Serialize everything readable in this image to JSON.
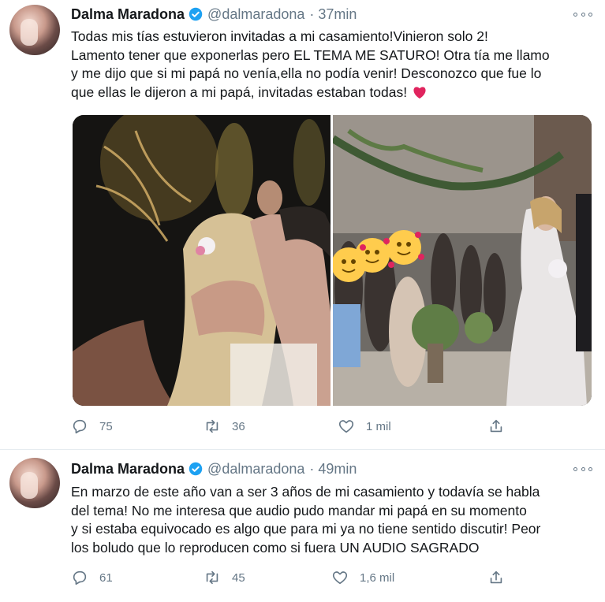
{
  "tweets": [
    {
      "author": "Dalma Maradona",
      "handle": "@dalmaradona",
      "time": "· 37min",
      "text": "Todas mis tías estuvieron invitadas a mi casamiento!Vinieron solo 2!\nLamento tener que exponerlas pero EL TEMA ME SATURO! Otra tía me llamo\ny me dijo que si mi papá no venía,ella no podía venir! Desconozco que fue lo\nque ellas le dijeron a mi papá, invitadas estaban todas!",
      "replies": "75",
      "retweets": "36",
      "likes": "1 mil"
    },
    {
      "author": "Dalma Maradona",
      "handle": "@dalmaradona",
      "time": "· 49min",
      "text": "En marzo de este año van a ser 3 años de mi casamiento y todavía se habla\ndel tema! No me interesa que audio pudo mandar mi papá en su momento\ny si estaba equivocado es algo que para mi ya no tiene sentido discutir! Peor\nlos boludo que lo reproducen como si fuera UN AUDIO SAGRADO",
      "replies": "61",
      "retweets": "45",
      "likes": "1,6 mil"
    }
  ],
  "colors": {
    "verified": "#1da1f2",
    "heart": "#e0245e",
    "muted": "#657786"
  }
}
